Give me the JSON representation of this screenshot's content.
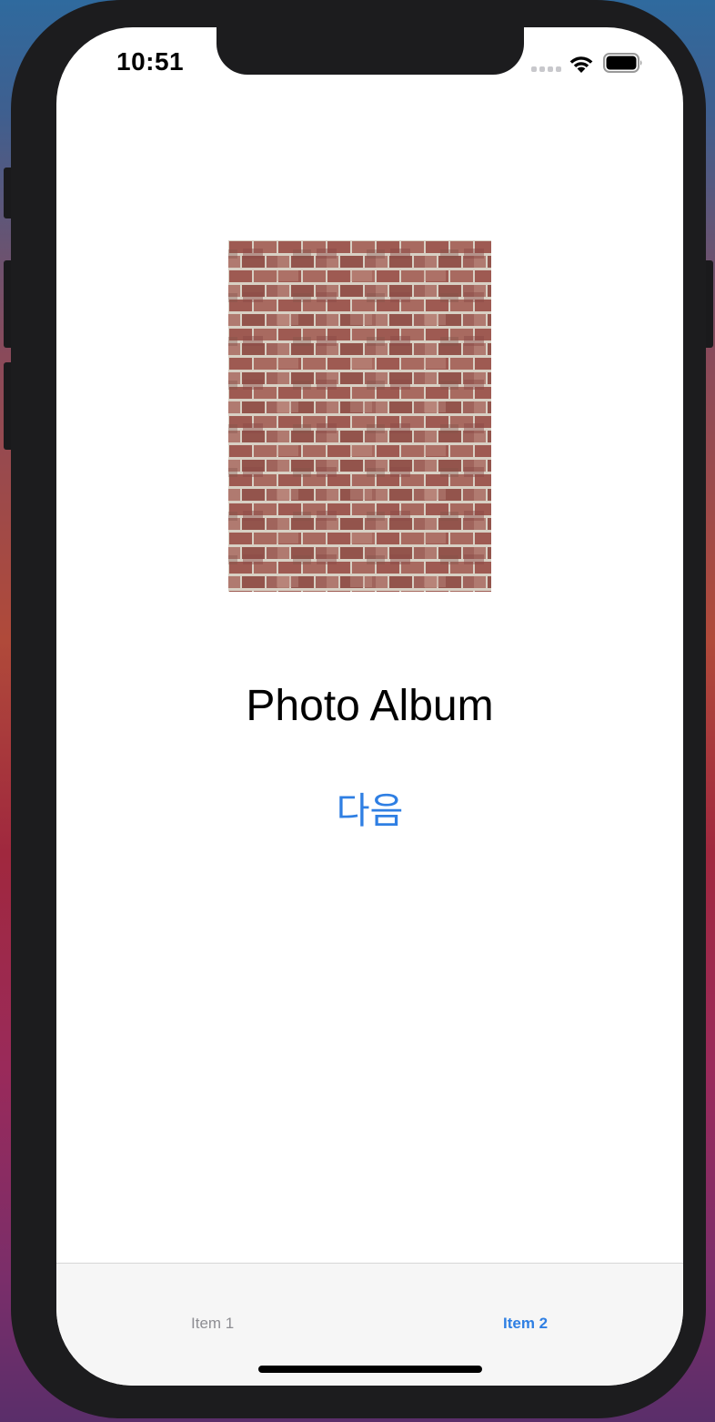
{
  "status_bar": {
    "time": "10:51"
  },
  "main": {
    "image": {
      "icon": "brick-wall-photo"
    },
    "title": "Photo Album",
    "next_button_label": "다음"
  },
  "tab_bar": {
    "items": [
      {
        "label": "Item 1",
        "selected": false
      },
      {
        "label": "Item 2",
        "selected": true
      }
    ]
  },
  "colors": {
    "accent": "#2f7fe3",
    "tab_inactive": "#8e8e93",
    "tab_bar_bg": "#f6f6f6",
    "phone_frame": "#1c1c1e"
  }
}
